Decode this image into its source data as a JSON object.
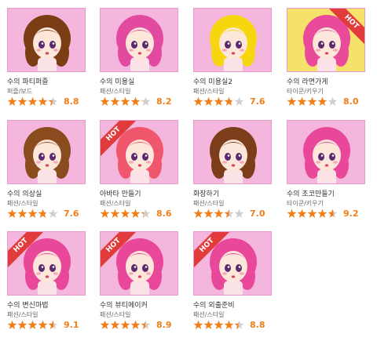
{
  "cards": [
    {
      "title": "수의 파티퍼즐",
      "category": "퍼즐/보드",
      "rating": "8.8",
      "stars": 4.4,
      "hot": false,
      "hair": "#7a3d14",
      "bg": "#f4b6dc"
    },
    {
      "title": "수의 미용실",
      "category": "패션/스타일",
      "rating": "8.2",
      "stars": 4.1,
      "hot": false,
      "hair": "#e24aa0",
      "bg": "#f4b6dc"
    },
    {
      "title": "수의 미용실2",
      "category": "패션/스타일",
      "rating": "7.6",
      "stars": 3.8,
      "hot": false,
      "hair": "#f5d60f",
      "bg": "#f4b6dc"
    },
    {
      "title": "수의 라면가게",
      "category": "타이쿤/키우기",
      "rating": "8.0",
      "stars": 4.0,
      "hot": true,
      "hair": "#ea4a9a",
      "bg": "#f6e26a"
    },
    {
      "title": "수의 의상실",
      "category": "패션/스타일",
      "rating": "7.6",
      "stars": 3.8,
      "hot": false,
      "hair": "#8a4b1e",
      "bg": "#f4b6dc"
    },
    {
      "title": "아바타 만들기",
      "category": "패션/스타일",
      "rating": "8.6",
      "stars": 4.3,
      "hot": true,
      "hair": "#f0576c",
      "bg": "#f4b6dc"
    },
    {
      "title": "화장하기",
      "category": "패션/스타일",
      "rating": "7.0",
      "stars": 3.5,
      "hot": false,
      "hair": "#7b3d1a",
      "bg": "#f4b6dc"
    },
    {
      "title": "수의 초코만들기",
      "category": "타이쿤/키우기",
      "rating": "9.2",
      "stars": 4.6,
      "hot": false,
      "hair": "#e9489a",
      "bg": "#f4b6dc"
    },
    {
      "title": "수의 변신마법",
      "category": "패션/스타일",
      "rating": "9.1",
      "stars": 4.55,
      "hot": true,
      "hair": "#e9489a",
      "bg": "#f4b6dc"
    },
    {
      "title": "수의 뷰티메이커",
      "category": "패션/스타일",
      "rating": "8.9",
      "stars": 4.45,
      "hot": true,
      "hair": "#e9489a",
      "bg": "#f4b6dc"
    },
    {
      "title": "수의 외출준비",
      "category": "패션/스타일",
      "rating": "8.8",
      "stars": 4.4,
      "hot": true,
      "hair": "#e9489a",
      "bg": "#f4b6dc"
    }
  ],
  "hot_label": "HOT",
  "colors": {
    "star": "#f07f1a",
    "star_empty": "#cfcfcf",
    "score": "#f07f1a",
    "hot": "#e23b3b",
    "thumb_border": "#e79ac9"
  }
}
